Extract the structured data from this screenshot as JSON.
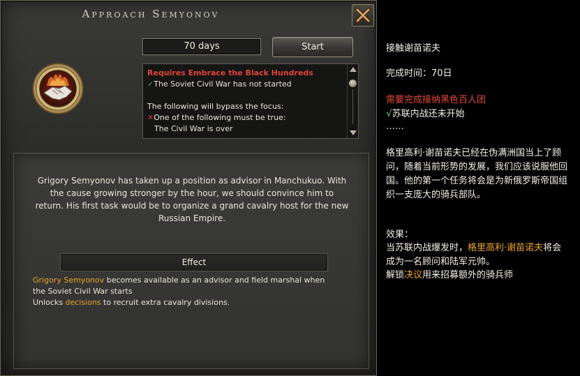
{
  "window": {
    "title": "Approach Semyonov",
    "close_icon": "close-x-icon"
  },
  "focus": {
    "duration": "70 days",
    "start_label": "Start",
    "emblem_icon": "handshake-flame-emblem-icon"
  },
  "requirements": {
    "requires": "Requires Embrace the Black Hundreds",
    "condition1": "The Soviet Civil War has not started",
    "bypass_header": "The following will bypass the focus:",
    "one_of": "One of the following must be true:",
    "civil_war_over": "The Civil War is over"
  },
  "description": "Grigory Semyonov has taken up a position as advisor in Manchukuo. With the cause growing stronger by the hour, we should convince him to return. His first task would be to organize a grand cavalry host for the new Russian Empire.",
  "effect": {
    "header": "Effect",
    "name": "Grigory Semyonov",
    "line1_rest": " becomes available as an advisor and field marshal when",
    "line2": "the Soviet Civil War starts",
    "line3_pre": "Unlocks ",
    "line3_link": "decisions",
    "line3_post": " to recruit extra cavalry divisions."
  },
  "translation": {
    "title": "接触谢苗诺夫",
    "time": "完成时间：70日",
    "requires": "需要完成接纳黑色百人团",
    "condition": "苏联内战还未开始",
    "ellipsis": "……",
    "description": "格里高利·谢苗诺夫已经在伪满洲国当上了顾问，随着当前形势的发展，我们应该说服他回国。他的第一个任务将会是为新俄罗斯帝国组织一支庞大的骑兵部队。",
    "effect_label": "效果：",
    "effect_pre": "当苏联内战爆发时，",
    "effect_name": "格里高利·谢苗诺夫",
    "effect_mid": "将会成为一名顾问和陆军元帅。",
    "unlock_pre": "解锁",
    "unlock_link": "决议",
    "unlock_post": "用来招募额外的骑兵师"
  },
  "colors": {
    "requirement_red": "#e0443a",
    "highlight_gold": "#e7a52a",
    "check_green": "#3fb03f"
  }
}
